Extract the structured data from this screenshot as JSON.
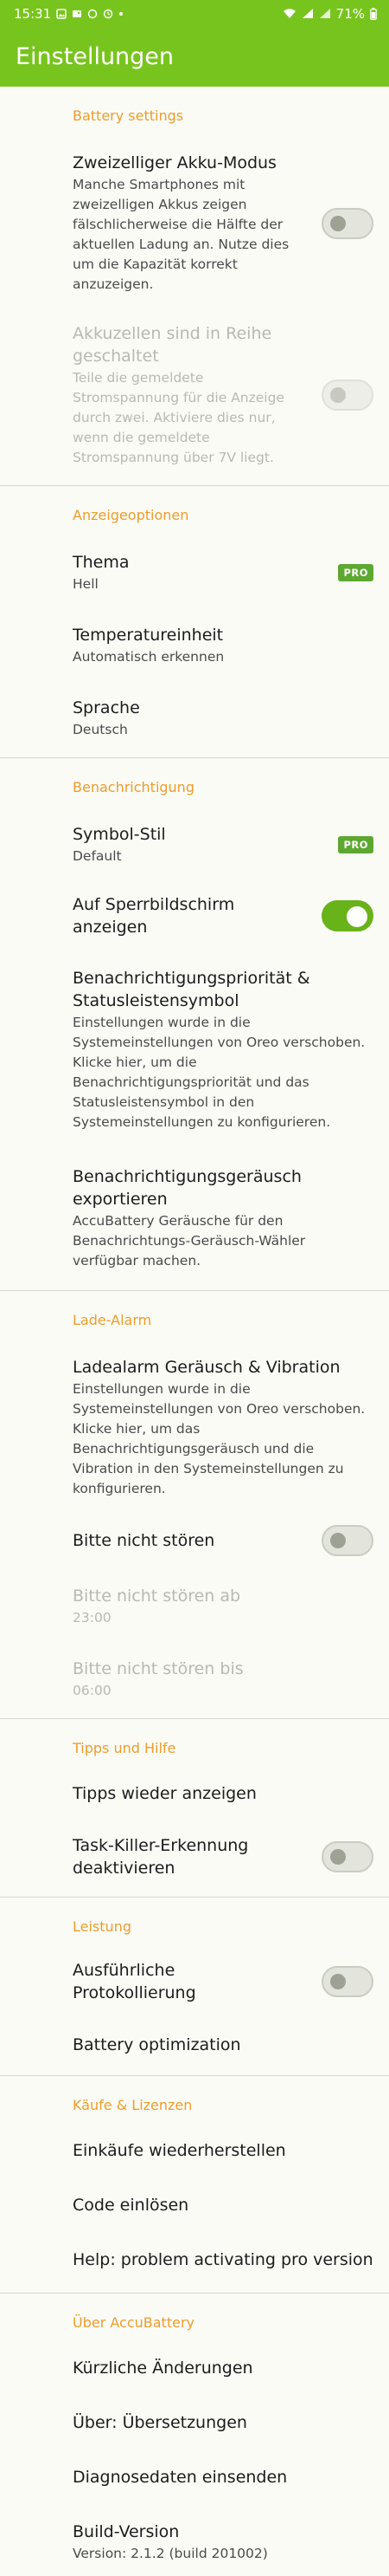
{
  "statusbar": {
    "time": "15:31",
    "battery_percent": "71%"
  },
  "appbar": {
    "title": "Einstellungen"
  },
  "sections": {
    "battery": {
      "title": "Battery settings",
      "dual_cell": {
        "title": "Zweizelliger Akku-Modus",
        "summary": "Manche Smartphones mit zweizelligen Akkus zeigen fälschlicherweise die Hälfte der aktuellen Ladung an. Nutze dies um die Kapazität korrekt anzuzeigen.",
        "enabled": false
      },
      "series_cells": {
        "title": "Akkuzellen sind in Reihe geschaltet",
        "summary": "Teile die gemeldete Stromspannung für die Anzeige durch zwei. Aktiviere dies nur, wenn die gemeldete Stromspannung über 7V liegt.",
        "enabled": false
      }
    },
    "display": {
      "title": "Anzeigeoptionen",
      "theme": {
        "title": "Thema",
        "value": "Hell",
        "badge": "PRO"
      },
      "temperature": {
        "title": "Temperatureinheit",
        "value": "Automatisch erkennen"
      },
      "language": {
        "title": "Sprache",
        "value": "Deutsch"
      }
    },
    "notification": {
      "title": "Benachrichtigung",
      "symbol_style": {
        "title": "Symbol-Stil",
        "value": "Default",
        "badge": "PRO"
      },
      "lockscreen": {
        "title": "Auf Sperrbildschirm anzeigen",
        "enabled": true
      },
      "priority": {
        "title": "Benachrichtigungspriorität & Statusleistensymbol",
        "summary": "Einstellungen wurde in die Systemeinstellungen von Oreo verschoben. Klicke hier, um die Benachrichtigungspriorität und das Statusleistensymbol in den Systemeinstellungen zu konfigurieren."
      },
      "export_sound": {
        "title": "Benachrichtigungsgeräusch exportieren",
        "summary": "AccuBattery Geräusche für den Benachrichtungs-Geräusch-Wähler verfügbar machen."
      }
    },
    "charge_alarm": {
      "title": "Lade-Alarm",
      "sound_vibration": {
        "title": "Ladealarm Geräusch & Vibration",
        "summary": "Einstellungen wurde in die Systemeinstellungen von Oreo verschoben. Klicke hier, um das Benachrichtigungsgeräusch und die Vibration in den Systemeinstellungen zu konfigurieren."
      },
      "dnd": {
        "title": "Bitte nicht stören",
        "enabled": false
      },
      "dnd_from": {
        "title": "Bitte nicht stören ab",
        "value": "23:00"
      },
      "dnd_until": {
        "title": "Bitte nicht stören bis",
        "value": "06:00"
      }
    },
    "tips": {
      "title": "Tipps und Hilfe",
      "show_tips": {
        "title": "Tipps wieder anzeigen"
      },
      "task_killer": {
        "title": "Task-Killer-Erkennung deaktivieren",
        "enabled": false
      }
    },
    "performance": {
      "title": "Leistung",
      "verbose_logging": {
        "title": "Ausführliche Protokollierung",
        "enabled": false
      },
      "battery_optimization": {
        "title": "Battery optimization"
      }
    },
    "purchases": {
      "title": "Käufe & Lizenzen",
      "restore": {
        "title": "Einkäufe wiederherstellen"
      },
      "redeem": {
        "title": "Code einlösen"
      },
      "help_pro": {
        "title": "Help: problem activating pro version"
      }
    },
    "about": {
      "title": "Über AccuBattery",
      "changelog": {
        "title": "Kürzliche Änderungen"
      },
      "translations": {
        "title": "Über: Übersetzungen"
      },
      "diagnostics": {
        "title": "Diagnosedaten einsenden"
      },
      "build": {
        "title": "Build-Version",
        "value": "Version: 2.1.2 (build 201002)"
      }
    }
  }
}
